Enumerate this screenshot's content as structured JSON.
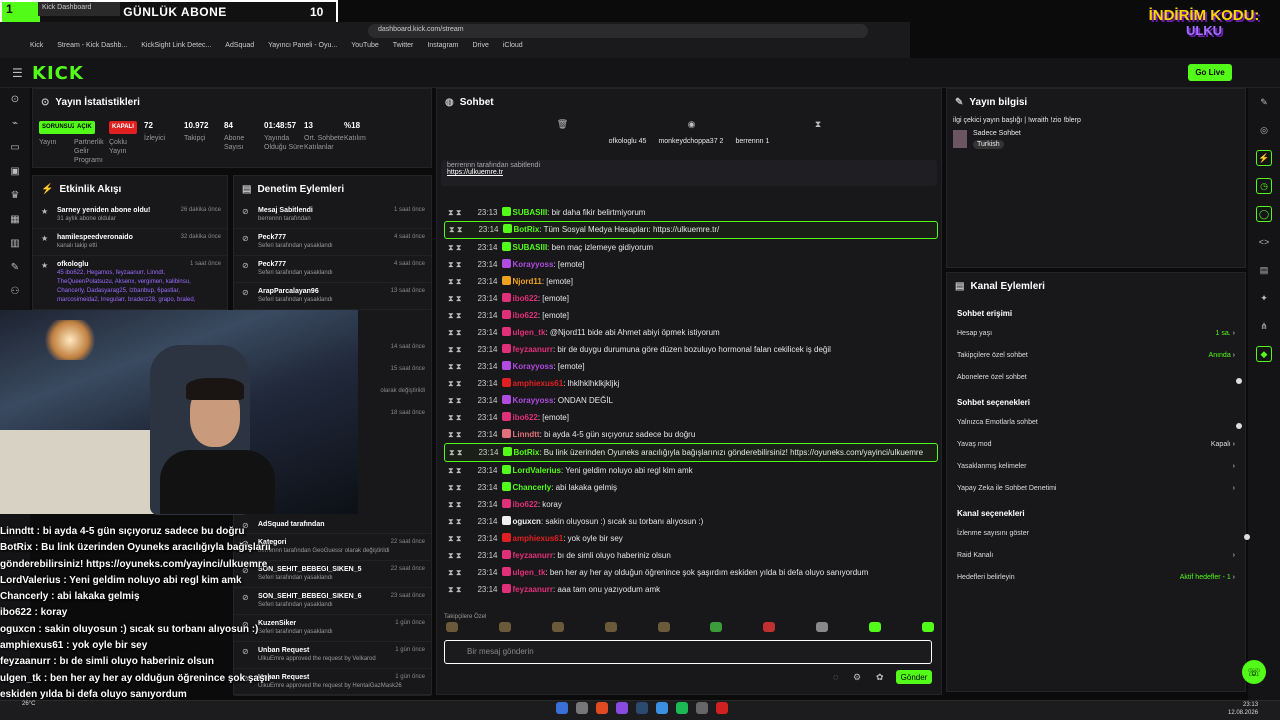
{
  "overlay": {
    "num": "1",
    "title": "GÜNLÜK ABONE",
    "count": "10",
    "tab_title": "Kick Dashboard",
    "promo_top": "İNDİRİM KODU:",
    "promo_code": "ULKU"
  },
  "browser": {
    "url": "dashboard.kick.com/stream",
    "bookmarks": [
      "Kick",
      "Stream - Kick Dashb...",
      "KickSight Link Detec...",
      "AdSquad",
      "Yayıncı Paneli - Oyu...",
      "YouTube",
      "Twitter",
      "Instagram",
      "Drive",
      "iCloud"
    ]
  },
  "header": {
    "logo": "KICK",
    "go_live": "Go Live"
  },
  "stats": {
    "title": "Yayın İstatistikleri",
    "items": [
      {
        "value": "SORUNSUZ",
        "label": "Yayın",
        "pill": "#53fc18"
      },
      {
        "value": "AÇIK",
        "label": "Partnerlik Gelir Programı",
        "pill": "#53fc18"
      },
      {
        "value": "KAPALI",
        "label": "Çoklu Yayın",
        "pill": "#e02020"
      },
      {
        "value": "72",
        "label": "İzleyici"
      },
      {
        "value": "10.972",
        "label": "Takipçi"
      },
      {
        "value": "84",
        "label": "Abone Sayısı"
      },
      {
        "value": "01:48:57",
        "label": "Yayında Olduğu Süre"
      },
      {
        "value": "13",
        "label": "Ort. Sohbete Katılanlar"
      },
      {
        "value": "%18",
        "label": "Katılım"
      }
    ]
  },
  "activity": {
    "title": "Etkinlik Akışı",
    "items": [
      {
        "name": "Sarney yeniden abone oldu!",
        "sub": "31 aylık abone oldular",
        "time": "26 dakika önce"
      },
      {
        "name": "hamilespeedveronaido",
        "sub": "kanalı takip etti",
        "time": "32 dakika önce"
      },
      {
        "name": "ofkologlu",
        "sub": "45 ibo622, Hegamos, feyzaanurr, Linndt, TheQueenPolatsuzu, Aksenx, vergimen, kalibinsu, Chancerly, Dadasyarag25, Izbanbup, 6pastlar, marcosimeida2, lrregularr, braderz28, grapo, braled,",
        "time": "1 saat önce"
      }
    ]
  },
  "mod": {
    "title": "Denetim Eylemleri",
    "items": [
      {
        "name": "Mesaj Sabitlendi",
        "sub": "berrennn tarafından",
        "time": "1 saat önce"
      },
      {
        "name": "Peck777",
        "sub": "Seferi tarafından yasaklandı",
        "time": "4 saat önce"
      },
      {
        "name": "Peck777",
        "sub": "Seferi tarafından yasaklandı",
        "time": "4 saat önce"
      },
      {
        "name": "ArapParcalayan96",
        "sub": "Seferi tarafından yasaklandı",
        "time": "13 saat önce"
      }
    ],
    "lower": [
      {
        "name": "AdSquad tarafından",
        "sub": "",
        "time": ""
      },
      {
        "name": "Kategori",
        "sub": "berrennn tarafından GeoGuessr olarak değiştirildi",
        "time": "22 saat önce"
      },
      {
        "name": "SON_SEHIT_BEBEGI_SIKEN_5",
        "sub": "Seferi tarafından yasaklandı",
        "time": "22 saat önce"
      },
      {
        "name": "SON_SEHIT_BEBEGI_SIKEN_6",
        "sub": "Seferi tarafından yasaklandı",
        "time": "23 saat önce"
      },
      {
        "name": "KuzenSiker",
        "sub": "Seferi tarafından yasaklandı",
        "time": "1 gün önce"
      },
      {
        "name": "Unban Request",
        "sub": "UlkuEmre approved the request by Velkarod",
        "time": "1 gün önce"
      },
      {
        "name": "Unban Request",
        "sub": "UlkuEmre approved the request by HentaiGazMask26",
        "time": "1 gün önce"
      }
    ],
    "side_times": [
      "14 saat önce",
      "15 saat önce",
      "olarak değiştirildi",
      "18 saat önce"
    ]
  },
  "chat": {
    "title": "Sohbet",
    "top_users": [
      {
        "name": "ofkologlu",
        "n": "45"
      },
      {
        "name": "monkeydchoppa37",
        "n": "2"
      },
      {
        "name": "berrennn",
        "n": "1"
      }
    ],
    "pinned_by": "berrennn tarafından sabitlendi",
    "pinned_link": "https://ulkuemre.tr",
    "messages": [
      {
        "ts": "23:14",
        "user": "BotRix",
        "color": "#53fc18",
        "text": "Tüm Sosyal Medya Hesapları: https://ulkuemre.tr/",
        "hl": true
      },
      {
        "ts": "23:14",
        "user": "SUBASIII",
        "color": "#53fc18",
        "text": "ben maç izlemeye gidiyorum"
      },
      {
        "ts": "23:14",
        "user": "Korayyoss",
        "color": "#b04be0",
        "text": "[emote]"
      },
      {
        "ts": "23:14",
        "user": "Njord11",
        "color": "#f0a020",
        "text": "[emote]"
      },
      {
        "ts": "23:14",
        "user": "ibo622",
        "color": "#e0307a",
        "text": "[emote]"
      },
      {
        "ts": "23:14",
        "user": "ibo622",
        "color": "#e0307a",
        "text": "[emote]"
      },
      {
        "ts": "23:14",
        "user": "ulgen_tk",
        "color": "#e0307a",
        "text": "@Njord11 bide abi Ahmet abiyi öpmek istiyorum"
      },
      {
        "ts": "23:14",
        "user": "feyzaanurr",
        "color": "#e0307a",
        "text": "bir de duygu durumuna göre düzen bozuluyo hormonal falan cekilicek iş değil"
      },
      {
        "ts": "23:14",
        "user": "Korayyoss",
        "color": "#b04be0",
        "text": "[emote]"
      },
      {
        "ts": "23:14",
        "user": "amphiexus61",
        "color": "#e02020",
        "text": "lhklhklhklkjkljkj"
      },
      {
        "ts": "23:14",
        "user": "Korayyoss",
        "color": "#b04be0",
        "text": "ONDAN DEĞİL"
      },
      {
        "ts": "23:14",
        "user": "ibo622",
        "color": "#e0307a",
        "text": "[emote]"
      },
      {
        "ts": "23:14",
        "user": "Linndtt",
        "color": "#e0707a",
        "text": "bi ayda 4-5 gün sıçıyoruz sadece bu doğru"
      },
      {
        "ts": "23:14",
        "user": "BotRix",
        "color": "#53fc18",
        "text": "Bu link üzerinden Oyuneks aracılığıyla bağışlarınızı gönderebilirsiniz! https://oyuneks.com/yayinci/ulkuemre",
        "hl2": true
      },
      {
        "ts": "23:14",
        "user": "LordValerius",
        "color": "#53fc18",
        "text": "Yeni geldim noluyo abi regl kim amk"
      },
      {
        "ts": "23:14",
        "user": "Chancerly",
        "color": "#53fc18",
        "text": "abi lakaka gelmiş"
      },
      {
        "ts": "23:14",
        "user": "ibo622",
        "color": "#e0307a",
        "text": "koray"
      },
      {
        "ts": "23:14",
        "user": "oguxcn",
        "color": "#f0f0f0",
        "text": "sakin oluyosun :) sıcak su torbanı alıyosun :)"
      },
      {
        "ts": "23:14",
        "user": "amphiexus61",
        "color": "#e02020",
        "text": "yok oyle bir sey"
      },
      {
        "ts": "23:14",
        "user": "feyzaanurr",
        "color": "#e0307a",
        "text": "bı de simli oluyo haberiniz olsun"
      },
      {
        "ts": "23:14",
        "user": "ulgen_tk",
        "color": "#e0307a",
        "text": "ben her ay her ay olduğun öğrenince şok şaşırdım eskiden yılda bi defa oluyo sanıyordum"
      },
      {
        "ts": "23:14",
        "user": "feyzaanurr",
        "color": "#e0307a",
        "text": "aaa tam onu yazıyodum amk"
      }
    ],
    "earlier": [
      {
        "ts": "23:13",
        "user": "SUBASIII",
        "color": "#53fc18",
        "text": "bir daha fikir belirtmiyorum"
      }
    ],
    "emote_label": "Takipçilere Özel",
    "input_placeholder": "Bir mesaj gönderin",
    "send": "Gönder"
  },
  "info": {
    "title": "Yayın bilgisi",
    "stream_title": "ilgi çekici yayın başlığı | !wraith !zio !blerp",
    "chat_mode": "Sadece Sohbet",
    "language": "Turkish"
  },
  "actions": {
    "title": "Kanal Eylemleri",
    "s1": "Sohbet erişimi",
    "r1": [
      {
        "k": "Hesap yaşı",
        "v": "1 sa."
      },
      {
        "k": "Takipçilere özel sohbet",
        "v": "Anında"
      },
      {
        "k": "Abonelere özel sohbet",
        "v": ""
      }
    ],
    "s2": "Sohbet seçenekleri",
    "r2": [
      {
        "k": "Yalnızca Emotlarla sohbet",
        "v": ""
      },
      {
        "k": "Yavaş mod",
        "v": "Kapalı"
      },
      {
        "k": "Yasaklanmış kelimeler",
        "v": ""
      },
      {
        "k": "Yapay Zeka ile Sohbet Denetimi",
        "v": ""
      }
    ],
    "s3": "Kanal seçenekleri",
    "r3": [
      {
        "k": "İzlenme sayısını göster",
        "v": ""
      },
      {
        "k": "Raid Kanalı",
        "v": ""
      },
      {
        "k": "Hedefleri belirleyin",
        "v": "Aktif hedefler - 1"
      }
    ]
  },
  "overlay_chat": [
    "Linndtt : bi ayda 4-5 gün sıçıyoruz sadece bu doğru",
    "BotRix : Bu link üzerinden Oyuneks aracılığıyla bağışlarınızı",
    "gönderebilirsiniz! https://oyuneks.com/yayinci/ulkuemre",
    "LordValerius : Yeni geldim noluyo abi regl kim amk",
    "Chancerly : abi lakaka gelmiş",
    "ibo622 : koray",
    "oguxcn : sakin oluyosun :) sıcak su torbanı alıyosun :)",
    "amphiexus61 : yok oyle bir sey",
    "feyzaanurr : bı de simli oluyo haberiniz olsun",
    "ulgen_tk : ben her ay her ay olduğun öğrenince şok şaşırdım",
    "eskiden yılda bi defa oluyo sanıyordum",
    "feyzaanurr : aaa tam onu yazıyodum amk"
  ],
  "taskbar": {
    "time": "23:13",
    "date": "12.08.2026",
    "temp": "26°C"
  }
}
